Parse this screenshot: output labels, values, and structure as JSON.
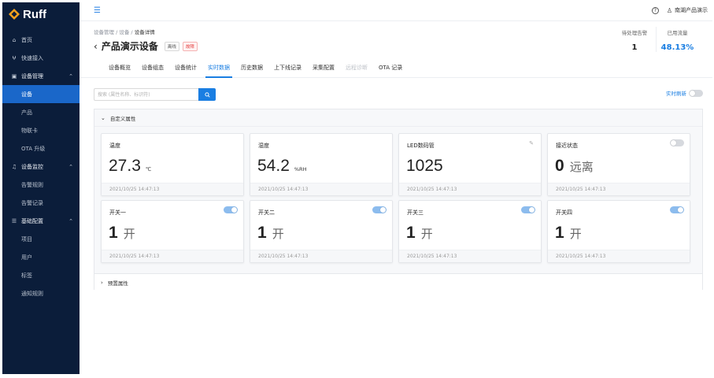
{
  "sidebar": {
    "logo": "Ruff",
    "items": [
      {
        "label": "首页",
        "icon": "home-icon",
        "glyph": "⌂"
      },
      {
        "label": "快速接入",
        "icon": "quick-access-icon",
        "glyph": "ⵖ"
      }
    ],
    "groups": [
      {
        "label": "设备管理",
        "icon": "device-icon",
        "glyph": "▣",
        "children": [
          "设备",
          "产品",
          "物联卡",
          "OTA 升级"
        ]
      },
      {
        "label": "设备监控",
        "icon": "bell-icon",
        "glyph": "♫",
        "children": [
          "告警规则",
          "告警记录"
        ]
      },
      {
        "label": "基础配置",
        "icon": "list-icon",
        "glyph": "☰",
        "children": [
          "项目",
          "用户",
          "标签",
          "通知规则"
        ]
      }
    ],
    "active": "设备",
    "colors": {
      "bg": "#0b1d3a",
      "active": "#1a67c9"
    }
  },
  "topbar": {
    "user": "南湖产品演示"
  },
  "header": {
    "breadcrumb": [
      "设备管理",
      "设备",
      "设备详情"
    ],
    "title": "产品演示设备",
    "badges": [
      "离线",
      "故障"
    ],
    "stats": [
      {
        "label": "待处理告警",
        "value": "1"
      },
      {
        "label": "已用流量",
        "value": "48.13%"
      }
    ]
  },
  "tabs": [
    {
      "label": "设备概览",
      "state": "normal"
    },
    {
      "label": "设备组态",
      "state": "normal"
    },
    {
      "label": "设备统计",
      "state": "normal"
    },
    {
      "label": "实时数据",
      "state": "active"
    },
    {
      "label": "历史数据",
      "state": "normal"
    },
    {
      "label": "上下线记录",
      "state": "normal"
    },
    {
      "label": "采集配置",
      "state": "normal"
    },
    {
      "label": "远程诊断",
      "state": "disabled"
    },
    {
      "label": "OTA 记录",
      "state": "normal"
    }
  ],
  "search": {
    "placeholder": "搜索 (属性名称、标识符)",
    "refresh_label": "实时刷新",
    "refresh_on": false
  },
  "panel": {
    "custom_title": "自定义属性",
    "preset_title": "预置属性"
  },
  "cards": [
    {
      "name": "温度",
      "value": "27.3",
      "unit": "℃",
      "state": "",
      "time": "2021/10/25 14:47:13",
      "control": "none"
    },
    {
      "name": "湿度",
      "value": "54.2",
      "unit": "%RH",
      "state": "",
      "time": "2021/10/25 14:47:13",
      "control": "none"
    },
    {
      "name": "LED数码管",
      "value": "1025",
      "unit": "",
      "state": "",
      "time": "2021/10/25 14:47:13",
      "control": "edit"
    },
    {
      "name": "接近状态",
      "value": "0",
      "unit": "",
      "state": "远离",
      "time": "2021/10/25 14:47:13",
      "control": "toggle-off"
    },
    {
      "name": "开关一",
      "value": "1",
      "unit": "",
      "state": "开",
      "time": "2021/10/25 14:47:13",
      "control": "toggle-on"
    },
    {
      "name": "开关二",
      "value": "1",
      "unit": "",
      "state": "开",
      "time": "2021/10/25 14:47:13",
      "control": "toggle-on"
    },
    {
      "name": "开关三",
      "value": "1",
      "unit": "",
      "state": "开",
      "time": "2021/10/25 14:47:13",
      "control": "toggle-on"
    },
    {
      "name": "开关四",
      "value": "1",
      "unit": "",
      "state": "开",
      "time": "2021/10/25 14:47:13",
      "control": "toggle-on"
    }
  ],
  "accent_color": "#1a7ee2"
}
